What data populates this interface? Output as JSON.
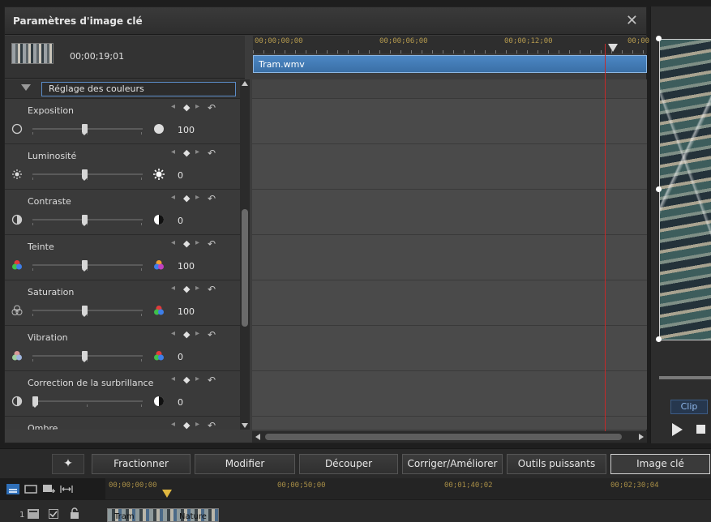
{
  "dialog": {
    "title": "Paramètres d'image clé",
    "close_glyph": "✕",
    "timecode": "00;00;19;01",
    "thumbnail": "clip-thumbnail"
  },
  "ruler": {
    "labels": [
      "00;00;00;00",
      "00;00;06;00",
      "00;00;12;00",
      "00;00"
    ]
  },
  "clip": {
    "name": "Tram.wmv"
  },
  "section": {
    "label": "Réglage des couleurs"
  },
  "params": [
    {
      "label": "Exposition",
      "value": "100",
      "level": 0.5,
      "left_icon": "circle-empty-icon",
      "right_icon": "circle-filled-icon"
    },
    {
      "label": "Luminosité",
      "value": "0",
      "level": 0.5,
      "left_icon": "sun-small-icon",
      "right_icon": "sun-large-icon"
    },
    {
      "label": "Contraste",
      "value": "0",
      "level": 0.5,
      "left_icon": "contrast-low-icon",
      "right_icon": "contrast-high-icon"
    },
    {
      "label": "Teinte",
      "value": "100",
      "level": 0.5,
      "left_icon": "rgb-circles-icon",
      "right_icon": "rgb-circles-shifted-icon"
    },
    {
      "label": "Saturation",
      "value": "100",
      "level": 0.5,
      "left_icon": "gray-circles-icon",
      "right_icon": "rgb-circles-icon"
    },
    {
      "label": "Vibration",
      "value": "0",
      "level": 0.5,
      "left_icon": "pale-circles-icon",
      "right_icon": "rgb-circles-icon"
    },
    {
      "label": "Correction de la surbrillance",
      "value": "0",
      "level": 0.0,
      "left_icon": "contrast-low-icon",
      "right_icon": "contrast-high-icon"
    },
    {
      "label": "Ombre",
      "value": "",
      "level": 0.5,
      "left_icon": "",
      "right_icon": ""
    }
  ],
  "keyframe_glyphs": {
    "prev": "◂",
    "add": "◆",
    "next": "▸",
    "reset": "↶"
  },
  "preview": {
    "tab": "Clip"
  },
  "toolbar": {
    "magic_glyph": "✦",
    "buttons": [
      "Fractionner",
      "Modifier",
      "Découper",
      "Corriger/Améliorer",
      "Outils puissants",
      "Image clé"
    ],
    "active": "Image clé"
  },
  "timeline": {
    "labels": [
      "00;00;00;00",
      "00;00;50;00",
      "00;01;40;02",
      "00;02;30;04"
    ],
    "track_number": "1",
    "clip_labels": [
      "Tram",
      "Nature"
    ]
  },
  "colors": {
    "accent": "#4c87c4",
    "playhead": "#c42a2a",
    "timecode": "#b59a4e"
  }
}
